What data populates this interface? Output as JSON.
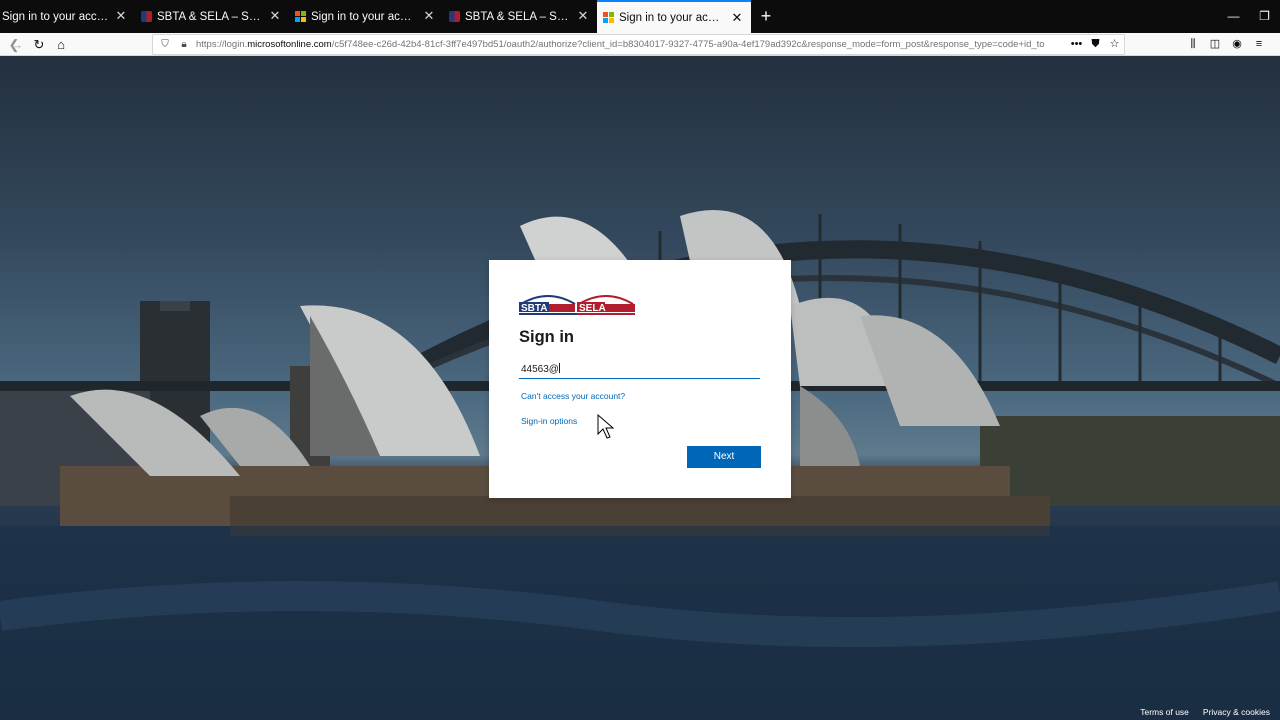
{
  "browser": {
    "tabs": [
      {
        "title": "Sign in to your account",
        "favicon": "microsoft-icon",
        "active": false
      },
      {
        "title": "SBTA & SELA – Sydney Business",
        "favicon": "sbta-icon",
        "active": false
      },
      {
        "title": "Sign in to your account",
        "favicon": "microsoft-icon",
        "active": false
      },
      {
        "title": "SBTA & SELA – Sydney Business",
        "favicon": "sbta-icon",
        "active": false
      },
      {
        "title": "Sign in to your account",
        "favicon": "microsoft-icon",
        "active": true
      }
    ],
    "new_tab": "+",
    "window_controls": {
      "minimize": "—",
      "restore": "❐"
    },
    "url_prefix": "https://login.",
    "url_domain": "microsoftonline.com",
    "url_rest": "/c5f748ee-c26d-42b4-81cf-3ff7e497bd51/oauth2/authorize?client_id=b8304017-9327-4775-a90a-4ef179ad392c&response_mode=form_post&response_type=code+id_to",
    "url_more": "•••"
  },
  "signin": {
    "logo_left_text": "SBTA",
    "logo_right_text": "SELA",
    "heading": "Sign in",
    "email_value": "44563@",
    "cant_access_link": "Can't access your account?",
    "options_link": "Sign-in options",
    "next_button": "Next"
  },
  "footer": {
    "terms": "Terms of use",
    "privacy": "Privacy & cookies"
  },
  "colors": {
    "accent": "#0067b8",
    "tab_active_indicator": "#0a84ff",
    "logo_blue": "#1f3b7a",
    "logo_red": "#b01e2d"
  }
}
